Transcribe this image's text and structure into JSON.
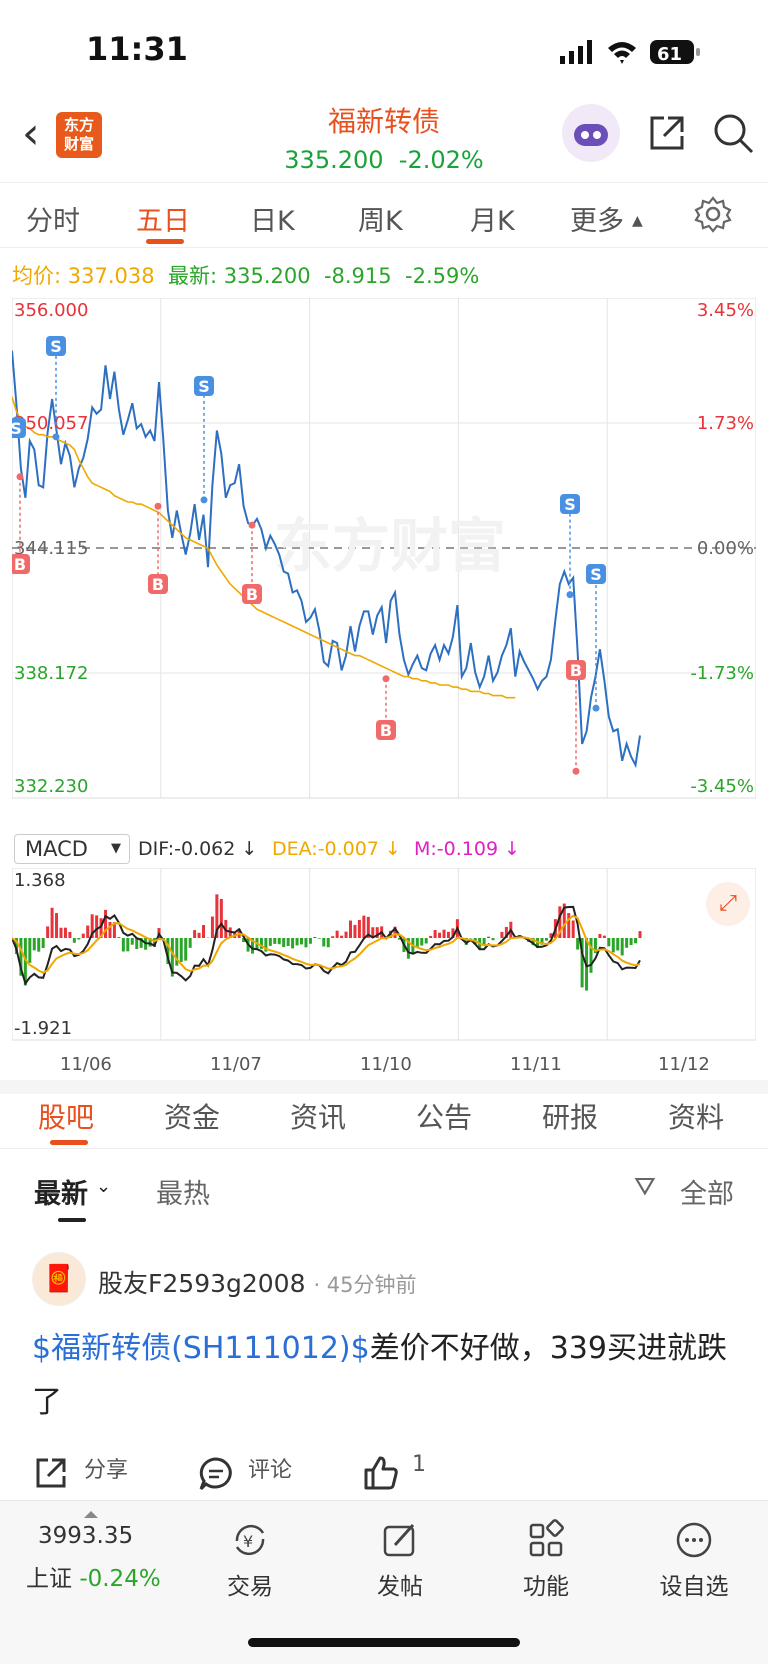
{
  "status": {
    "time": "11:31",
    "battery": "61"
  },
  "header": {
    "logo_text": "东方\n财富",
    "title": "福新转债",
    "price": "335.200",
    "change_pct": "-2.02%"
  },
  "tabs": [
    "分时",
    "五日",
    "日K",
    "周K",
    "月K",
    "更多"
  ],
  "active_tab": "五日",
  "info": {
    "avg_label": "均价:",
    "avg_value": "337.038",
    "latest_label": "最新:",
    "latest_value": "335.200",
    "change": "-8.915",
    "change_pct": "-2.59%"
  },
  "chart_data": {
    "type": "line",
    "x_labels": [
      "11/06",
      "11/07",
      "11/10",
      "11/11",
      "11/12"
    ],
    "ylim": [
      332.23,
      356.0
    ],
    "y_ticks": [
      "356.000",
      "350.057",
      "344.115",
      "338.172",
      "332.230"
    ],
    "pct_ticks": [
      "3.45%",
      "1.73%",
      "0.00%",
      "-1.73%",
      "-3.45%"
    ],
    "baseline": 344.115,
    "series": [
      {
        "values": [
          353.5,
          350.9,
          347.9,
          346.5,
          349.2,
          348.8,
          347.1,
          347.0,
          349.6,
          351.2,
          349.7,
          348.1,
          349.1,
          348.5,
          347.0,
          347.9,
          348.4,
          349.3,
          350.8,
          350.5,
          350.7,
          352.8,
          351.2,
          352.5,
          350.7,
          349.5,
          350.2,
          351.0,
          349.8,
          350.0,
          349.4,
          349.7,
          349.2,
          352.0,
          349.2,
          345.9,
          344.6,
          345.9,
          344.8,
          343.8,
          344.8,
          346.2,
          344.5,
          345.7,
          343.2,
          347.1,
          349.7,
          348.6,
          346.5,
          347.1,
          347.2,
          348.1,
          346.1,
          345.3,
          345.2,
          345.5,
          345.0,
          344.1,
          344.7,
          344.3,
          343.8,
          343.0,
          342.9,
          342.0,
          342.1,
          341.6,
          340.6,
          340.8,
          341.2,
          340.2,
          338.7,
          338.5,
          339.7,
          339.6,
          338.3,
          339.0,
          340.4,
          339.2,
          340.4,
          341.1,
          341.1,
          340.0,
          340.9,
          341.3,
          339.6,
          341.6,
          342.0,
          340.0,
          338.8,
          338.1,
          338.6,
          339.0,
          338.4,
          338.3,
          339.1,
          339.5,
          338.8,
          339.5,
          339.1,
          339.9,
          341.4,
          338.0,
          338.4,
          339.6,
          338.2,
          337.5,
          338.0,
          339.0,
          337.8,
          338.2,
          339.0,
          339.5,
          340.3,
          338.0,
          339.2,
          338.7,
          338.3,
          337.9,
          337.4,
          337.8,
          338.0,
          338.8,
          340.7,
          342.4,
          343.0,
          342.4,
          342.7,
          339.2,
          334.8,
          335.4,
          337.0,
          338.0,
          339.3,
          337.8,
          336.1,
          335.4,
          335.5,
          334.0,
          334.8,
          334.2,
          333.8,
          335.2
        ]
      },
      {
        "values": [
          351.3,
          350.6,
          350.2,
          349.9,
          349.8,
          349.6,
          349.5,
          349.5,
          349.4,
          349.4,
          349.3,
          349.2,
          349.1,
          349.0,
          348.8,
          348.3,
          347.9,
          347.5,
          347.2,
          347.1,
          347.0,
          346.9,
          346.8,
          346.6,
          346.5,
          346.4,
          346.3,
          346.3,
          346.2,
          346.2,
          346.1,
          346.0,
          345.9,
          345.8,
          345.6,
          345.4,
          345.2,
          345.0,
          344.8,
          344.6,
          344.5,
          344.4,
          344.3,
          344.2,
          344.1,
          343.7,
          343.3,
          343.0,
          342.7,
          342.4,
          342.2,
          342.0,
          341.8,
          341.6,
          341.4,
          341.2,
          341.1,
          341.0,
          340.9,
          340.8,
          340.7,
          340.6,
          340.5,
          340.4,
          340.3,
          340.2,
          340.1,
          340.0,
          339.9,
          339.8,
          339.7,
          339.6,
          339.5,
          339.4,
          339.3,
          339.2,
          339.1,
          339.0,
          339.0,
          338.9,
          338.8,
          338.7,
          338.6,
          338.5,
          338.4,
          338.3,
          338.2,
          338.1,
          338.0,
          338.0,
          337.9,
          337.9,
          337.8,
          337.8,
          337.7,
          337.7,
          337.6,
          337.6,
          337.6,
          337.5,
          337.5,
          337.4,
          337.4,
          337.3,
          337.3,
          337.3,
          337.2,
          337.2,
          337.1,
          337.1,
          337.1,
          337.0,
          337.0,
          337.0
        ]
      }
    ],
    "markers": [
      {
        "label": "S"
      },
      {
        "label": "S"
      },
      {
        "label": "S"
      },
      {
        "label": "S"
      },
      {
        "label": "S"
      },
      {
        "label": "B"
      },
      {
        "label": "B"
      },
      {
        "label": "B"
      },
      {
        "label": "B"
      },
      {
        "label": "B"
      }
    ],
    "macd": {
      "ylim": [
        -1.921,
        1.368
      ],
      "top_label": "1.368",
      "bottom_label": "-1.921"
    }
  },
  "macd_bar": {
    "indicator": "MACD",
    "dif": "DIF:-0.062 ↓",
    "dea": "DEA:-0.007 ↓",
    "m": "M:-0.109 ↓"
  },
  "watermark": "东方财富",
  "bottom_tabs": [
    "股吧",
    "资金",
    "资讯",
    "公告",
    "研报",
    "资料"
  ],
  "active_bottom_tab": "股吧",
  "sort": {
    "latest": "最新",
    "hot": "最热",
    "filter": "全部"
  },
  "post": {
    "user": "股友F2593g2008",
    "time": "· 45分钟前",
    "link": "$福新转债(SH111012)$",
    "text": "差价不好做，339买进就跌了",
    "share": "分享",
    "comment": "评论",
    "likes": "1"
  },
  "bottom_bar": {
    "index_value": "3993.35",
    "index_name": "上证",
    "index_change": "-0.24%",
    "trade": "交易",
    "post": "发帖",
    "functions": "功能",
    "watchlist": "设自选"
  },
  "colors": {
    "accent": "#e8501e",
    "up": "#e8333a",
    "down": "#2aa52a",
    "price_line": "#2d6fc0",
    "avg_line": "#f0a800"
  }
}
